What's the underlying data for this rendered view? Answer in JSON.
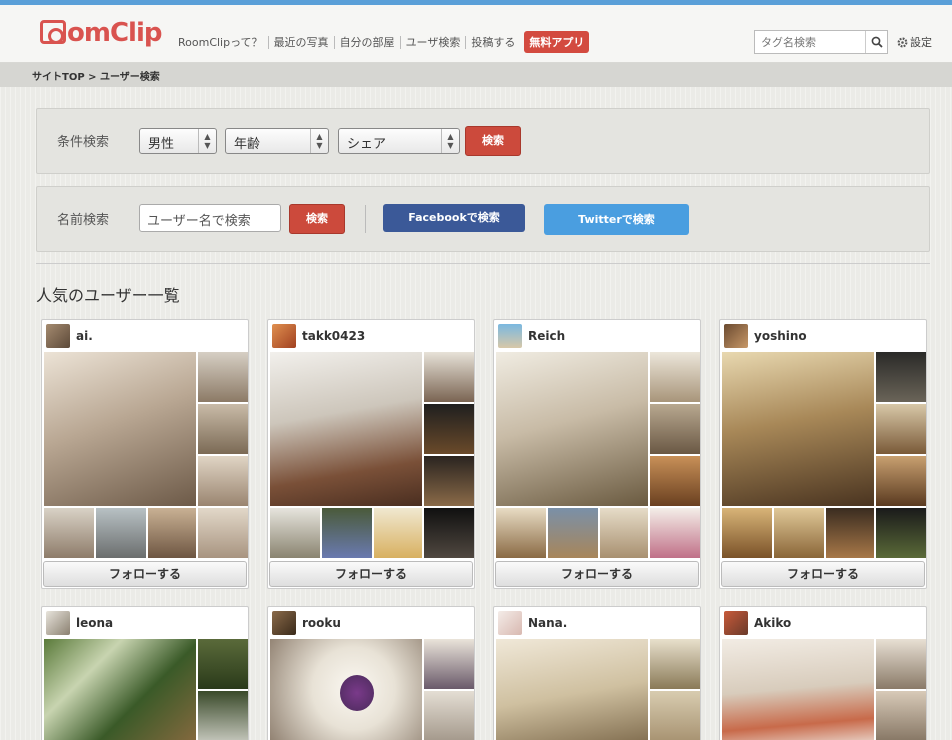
{
  "header": {
    "logo": "RoomClip",
    "logo_rest": "omClip",
    "nav": [
      "RoomClipって？",
      "最近の写真",
      "自分の部屋",
      "ユーザ検索",
      "投稿する"
    ],
    "app_button": "無料アプリ",
    "tag_search_placeholder": "タグ名検索",
    "settings_label": "設定"
  },
  "breadcrumb": "サイトTOP > ユーザー検索",
  "condition_search": {
    "label": "条件検索",
    "gender": "男性",
    "age": "年齢",
    "share": "シェア",
    "search_button": "検索"
  },
  "name_search": {
    "label": "名前検索",
    "placeholder": "ユーザー名で検索",
    "search_button": "検索",
    "facebook_button": "Facebookで検索",
    "twitter_button": "Twitterで検索"
  },
  "popular_title": "人気のユーザー一覧",
  "follow_label": "フォローする",
  "users": [
    {
      "name": "ai."
    },
    {
      "name": "takk0423"
    },
    {
      "name": "Reich"
    },
    {
      "name": "yoshino"
    },
    {
      "name": "leona"
    },
    {
      "name": "rooku"
    },
    {
      "name": "Nana."
    },
    {
      "name": "Akiko"
    }
  ],
  "colors": {
    "accent_red": "#cc4a3c",
    "facebook": "#3b5998",
    "twitter": "#4a9ee0",
    "topline": "#5a9fd8"
  }
}
